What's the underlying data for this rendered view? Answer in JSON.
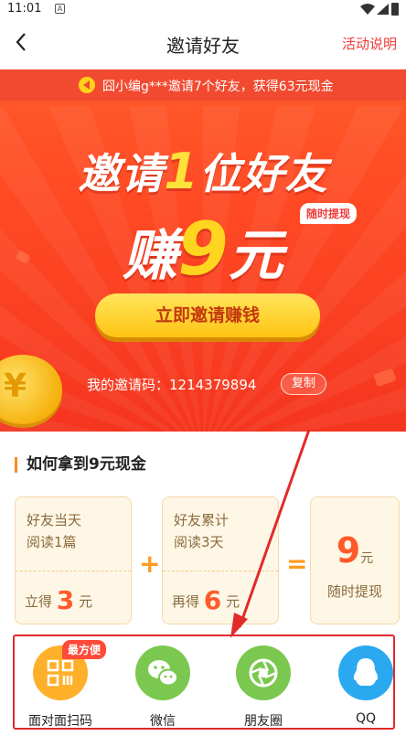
{
  "status_bar": {
    "time": "11:01",
    "sim_label": "A"
  },
  "nav": {
    "title": "邀请好友",
    "rules_link": "活动说明"
  },
  "hero": {
    "ticker": "囧小编g***邀请7个好友，获得63元现金",
    "headline_pre": "邀请",
    "headline_num": "1",
    "headline_post": "位好友",
    "earn_pre": "赚",
    "earn_num": "9",
    "earn_post": "元",
    "tag": "随时提现",
    "cta": "立即邀请赚钱",
    "invite_code": "我的邀请码：1214379894",
    "copy_button": "复制"
  },
  "how": {
    "title": "如何拿到9元现金",
    "cards": [
      {
        "line1": "好友当天",
        "line2": "阅读1篇",
        "bottom_pre": "立得",
        "amount": "3",
        "unit": "元"
      },
      {
        "line1": "好友累计",
        "line2": "阅读3天",
        "bottom_pre": "再得",
        "amount": "6",
        "unit": "元"
      }
    ],
    "plus": "+",
    "equals": "=",
    "total": {
      "amount": "9",
      "unit": "元",
      "subtitle": "随时提现"
    }
  },
  "share": {
    "badge": "最方便",
    "items": [
      {
        "label": "面对面扫码",
        "color": "#ffb02a"
      },
      {
        "label": "微信",
        "color": "#7bc850"
      },
      {
        "label": "朋友圈",
        "color": "#7bc850"
      },
      {
        "label": "QQ",
        "color": "#2aa9f0"
      }
    ]
  },
  "colors": {
    "brand_red": "#ef3b3b",
    "highlight_yellow": "#ffd51f",
    "annotation_red": "#e22a2a"
  }
}
